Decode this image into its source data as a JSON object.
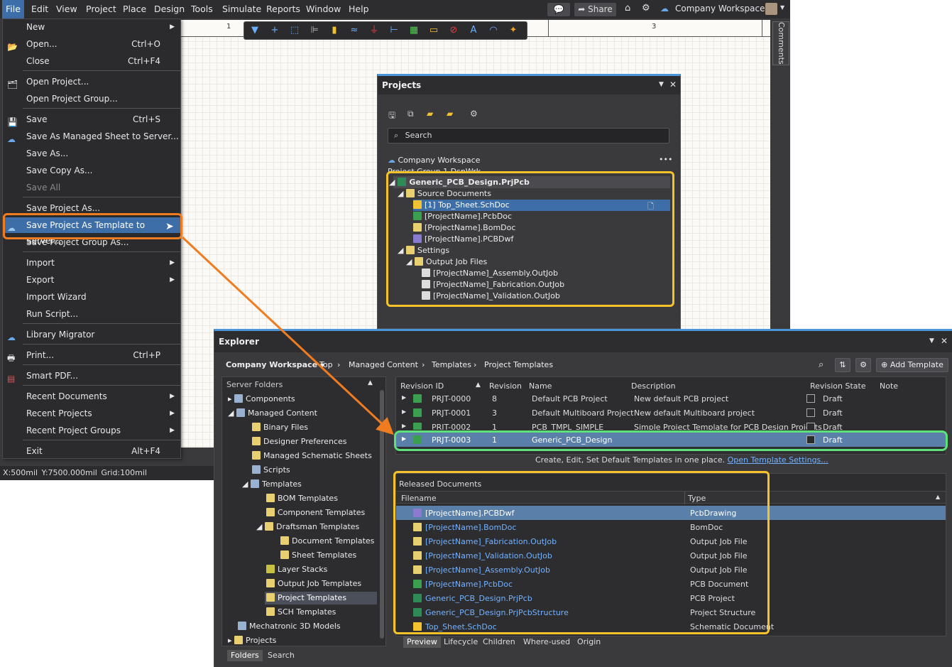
{
  "menubar": {
    "items": [
      "File",
      "Edit",
      "View",
      "Project",
      "Place",
      "Design",
      "Tools",
      "Simulate",
      "Reports",
      "Window",
      "Help"
    ],
    "share": "Share",
    "workspace": "Company Workspace"
  },
  "comments_tab": "Comments",
  "ruler": {
    "mark1": "1",
    "mark3": "3"
  },
  "status_bar": "X:500mil Y:7500.000mil   Grid:100mil",
  "file_menu": [
    {
      "label": "New",
      "shortcut": "",
      "submenu": true
    },
    {
      "label": "Open...",
      "shortcut": "Ctrl+O"
    },
    {
      "label": "Close",
      "shortcut": "Ctrl+F4"
    },
    {
      "label": "Open Project..."
    },
    {
      "label": "Open Project Group..."
    },
    {
      "label": "Save",
      "shortcut": "Ctrl+S"
    },
    {
      "label": "Save As Managed Sheet to Server..."
    },
    {
      "label": "Save As..."
    },
    {
      "label": "Save Copy As..."
    },
    {
      "label": "Save All",
      "disabled": true
    },
    {
      "label": "Save Project As..."
    },
    {
      "label": "Save Project As Template to Server..."
    },
    {
      "label": "Save Project Group As..."
    },
    {
      "label": "Import",
      "submenu": true
    },
    {
      "label": "Export",
      "submenu": true
    },
    {
      "label": "Import Wizard"
    },
    {
      "label": "Run Script..."
    },
    {
      "label": "Library Migrator"
    },
    {
      "label": "Print...",
      "shortcut": "Ctrl+P"
    },
    {
      "label": "Smart PDF..."
    },
    {
      "label": "Recent Documents",
      "submenu": true
    },
    {
      "label": "Recent Projects",
      "submenu": true
    },
    {
      "label": "Recent Project Groups",
      "submenu": true
    },
    {
      "label": "Exit",
      "shortcut": "Alt+F4"
    }
  ],
  "projects_panel": {
    "title": "Projects",
    "search_placeholder": "Search",
    "workspace": "Company Workspace",
    "group": "Project Group 1.DsnWrk",
    "tree": [
      {
        "label": "Generic_PCB_Design.PrjPcb",
        "level": 0
      },
      {
        "label": "Source Documents",
        "level": 1
      },
      {
        "label": "[1] Top_Sheet.SchDoc",
        "level": 2
      },
      {
        "label": "[ProjectName].PcbDoc",
        "level": 2
      },
      {
        "label": "[ProjectName].BomDoc",
        "level": 2
      },
      {
        "label": "[ProjectName].PCBDwf",
        "level": 2
      },
      {
        "label": "Settings",
        "level": 1
      },
      {
        "label": "Output Job Files",
        "level": 2
      },
      {
        "label": "[ProjectName]_Assembly.OutJob",
        "level": 3
      },
      {
        "label": "[ProjectName]_Fabrication.OutJob",
        "level": 3
      },
      {
        "label": "[ProjectName]_Validation.OutJob",
        "level": 3
      }
    ]
  },
  "explorer": {
    "title": "Explorer",
    "workspace_dropdown": "Company Workspace",
    "breadcrumb": [
      "Top",
      "Managed Content",
      "Templates",
      "Project Templates"
    ],
    "add_template": "Add Template",
    "server_folders_header": "Server Folders",
    "folders": [
      {
        "label": "Components",
        "level": 0
      },
      {
        "label": "Managed Content",
        "level": 0
      },
      {
        "label": "Binary Files",
        "level": 1
      },
      {
        "label": "Designer Preferences",
        "level": 1
      },
      {
        "label": "Managed Schematic Sheets",
        "level": 1
      },
      {
        "label": "Scripts",
        "level": 1
      },
      {
        "label": "Templates",
        "level": 1
      },
      {
        "label": "BOM Templates",
        "level": 2
      },
      {
        "label": "Component Templates",
        "level": 2
      },
      {
        "label": "Draftsman Templates",
        "level": 2
      },
      {
        "label": "Document Templates",
        "level": 3
      },
      {
        "label": "Sheet Templates",
        "level": 3
      },
      {
        "label": "Layer Stacks",
        "level": 2
      },
      {
        "label": "Output Job Templates",
        "level": 2
      },
      {
        "label": "Project Templates",
        "level": 2
      },
      {
        "label": "SCH Templates",
        "level": 2
      },
      {
        "label": "Mechatronic 3D Models",
        "level": 0
      },
      {
        "label": "Projects",
        "level": 0
      }
    ],
    "left_tabs": [
      "Folders",
      "Search"
    ],
    "grid_headers": [
      "Revision ID",
      "Revision",
      "Name",
      "Description",
      "Revision State",
      "Note"
    ],
    "grid_rows": [
      {
        "id": "PRJT-0000",
        "rev": "8",
        "name": "Default PCB Project",
        "desc": "New default PCB project",
        "state": "Draft"
      },
      {
        "id": "PRJT-0001",
        "rev": "3",
        "name": "Default Multiboard Project",
        "desc": "New default Multiboard project",
        "state": "Draft"
      },
      {
        "id": "PRJT-0002",
        "rev": "1",
        "name": "PCB_TMPL_SIMPLE",
        "desc": "Simple Project Template for PCB Design Projects",
        "state": "Draft"
      },
      {
        "id": "PRJT-0003",
        "rev": "1",
        "name": "Generic_PCB_Design",
        "desc": "",
        "state": "Draft"
      }
    ],
    "info_text": "Create, Edit, Set Default Templates in one place.",
    "info_link": "Open Template Settings...",
    "released_header": "Released Documents",
    "released_cols": [
      "Filename",
      "Type"
    ],
    "released": [
      {
        "file": "[ProjectName].PCBDwf",
        "type": "PcbDrawing"
      },
      {
        "file": "[ProjectName].BomDoc",
        "type": "BomDoc"
      },
      {
        "file": "[ProjectName]_Fabrication.OutJob",
        "type": "Output Job File"
      },
      {
        "file": "[ProjectName]_Validation.OutJob",
        "type": "Output Job File"
      },
      {
        "file": "[ProjectName]_Assembly.OutJob",
        "type": "Output Job File"
      },
      {
        "file": "[ProjectName].PcbDoc",
        "type": "PCB Document"
      },
      {
        "file": "Generic_PCB_Design.PrjPcb",
        "type": "PCB Project"
      },
      {
        "file": "Generic_PCB_Design.PrjPcbStructure",
        "type": "Project Structure"
      },
      {
        "file": "Top_Sheet.SchDoc",
        "type": "Schematic Document"
      }
    ],
    "bottom_tabs": [
      "Preview",
      "Lifecycle",
      "Children",
      "Where-used",
      "Origin"
    ]
  },
  "colors": {
    "highlight_orange": "#f07c20",
    "highlight_yellow": "#f6c22a",
    "highlight_green": "#5ee07a",
    "selection": "#3d6ea8"
  }
}
